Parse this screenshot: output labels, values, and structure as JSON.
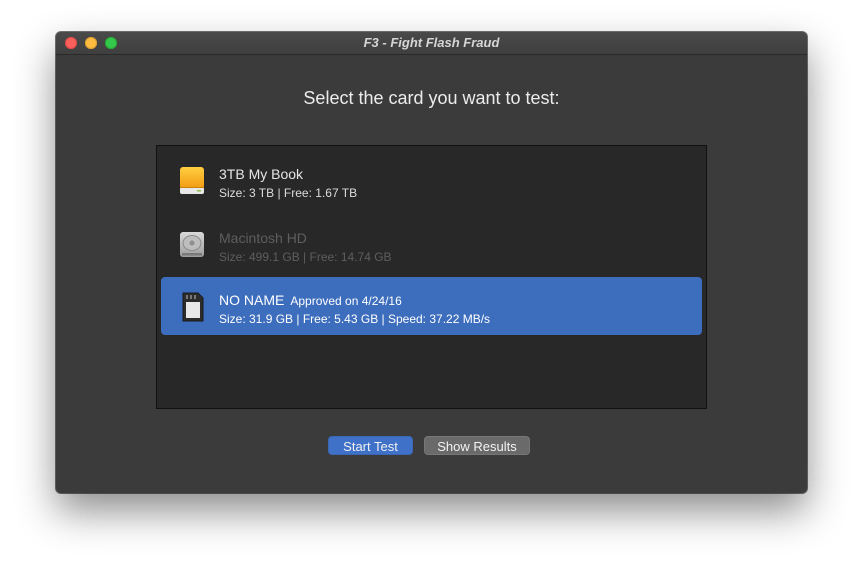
{
  "window": {
    "title": "F3 - Fight Flash Fraud"
  },
  "prompt": "Select the card you want to test:",
  "drives": [
    {
      "name": "3TB My Book",
      "badge": "",
      "details": "Size: 3 TB | Free: 1.67 TB",
      "icon": "external-drive-icon",
      "state": "normal"
    },
    {
      "name": "Macintosh HD",
      "badge": "",
      "details": "Size: 499.1 GB | Free: 14.74 GB",
      "icon": "internal-drive-icon",
      "state": "disabled"
    },
    {
      "name": "NO NAME",
      "badge": "Approved on 4/24/16",
      "details": "Size: 31.9 GB | Free: 5.43 GB | Speed: 37.22 MB/s",
      "icon": "sd-card-icon",
      "state": "selected"
    }
  ],
  "buttons": {
    "start": "Start Test",
    "results": "Show Results"
  },
  "colors": {
    "accent": "#3d6dbd",
    "window_bg": "#3b3b3b",
    "list_bg": "#282828"
  }
}
